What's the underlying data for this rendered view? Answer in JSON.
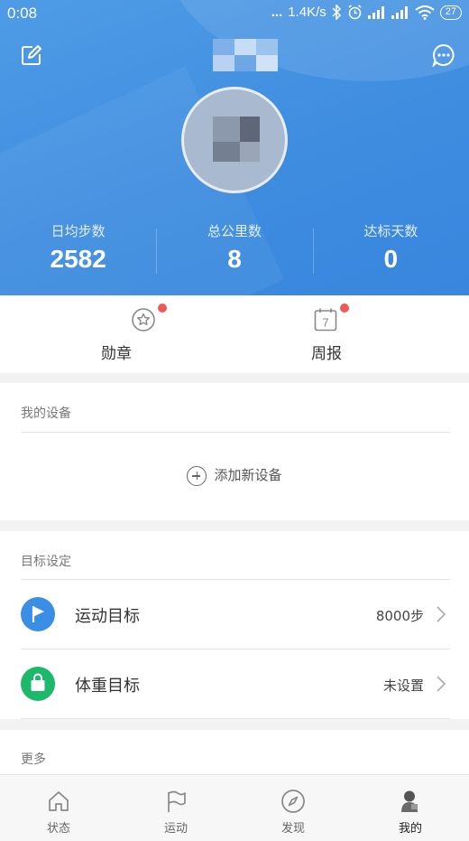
{
  "status_bar": {
    "time": "0:08",
    "dots": "...",
    "network_speed": "1.4K/s",
    "battery": "27"
  },
  "header": {
    "edit_icon": "edit-icon",
    "message_icon": "message-icon",
    "stats": [
      {
        "label": "日均步数",
        "value": "2582"
      },
      {
        "label": "总公里数",
        "value": "8"
      },
      {
        "label": "达标天数",
        "value": "0"
      }
    ]
  },
  "badges": [
    {
      "label": "勋章",
      "icon": "star-badge-icon",
      "has_dot": true
    },
    {
      "label": "周报",
      "icon": "calendar-icon",
      "calendar_day": "7",
      "has_dot": true
    }
  ],
  "devices": {
    "title": "我的设备",
    "add_label": "添加新设备"
  },
  "goals": {
    "title": "目标设定",
    "items": [
      {
        "label": "运动目标",
        "value": "8000步",
        "icon": "flag-icon",
        "color": "#3b8ee6"
      },
      {
        "label": "体重目标",
        "value": "未设置",
        "icon": "bag-icon",
        "color": "#1db86a"
      }
    ]
  },
  "more": {
    "title": "更多"
  },
  "tabs": [
    {
      "label": "状态",
      "icon": "home-icon"
    },
    {
      "label": "运动",
      "icon": "flag-outline-icon"
    },
    {
      "label": "发现",
      "icon": "compass-icon"
    },
    {
      "label": "我的",
      "icon": "profile-icon",
      "active": true
    }
  ],
  "colors": {
    "header_blue": "#3f8de0",
    "red_dot": "#f25757",
    "goal_blue": "#3b8ee6",
    "goal_green": "#1db86a"
  }
}
